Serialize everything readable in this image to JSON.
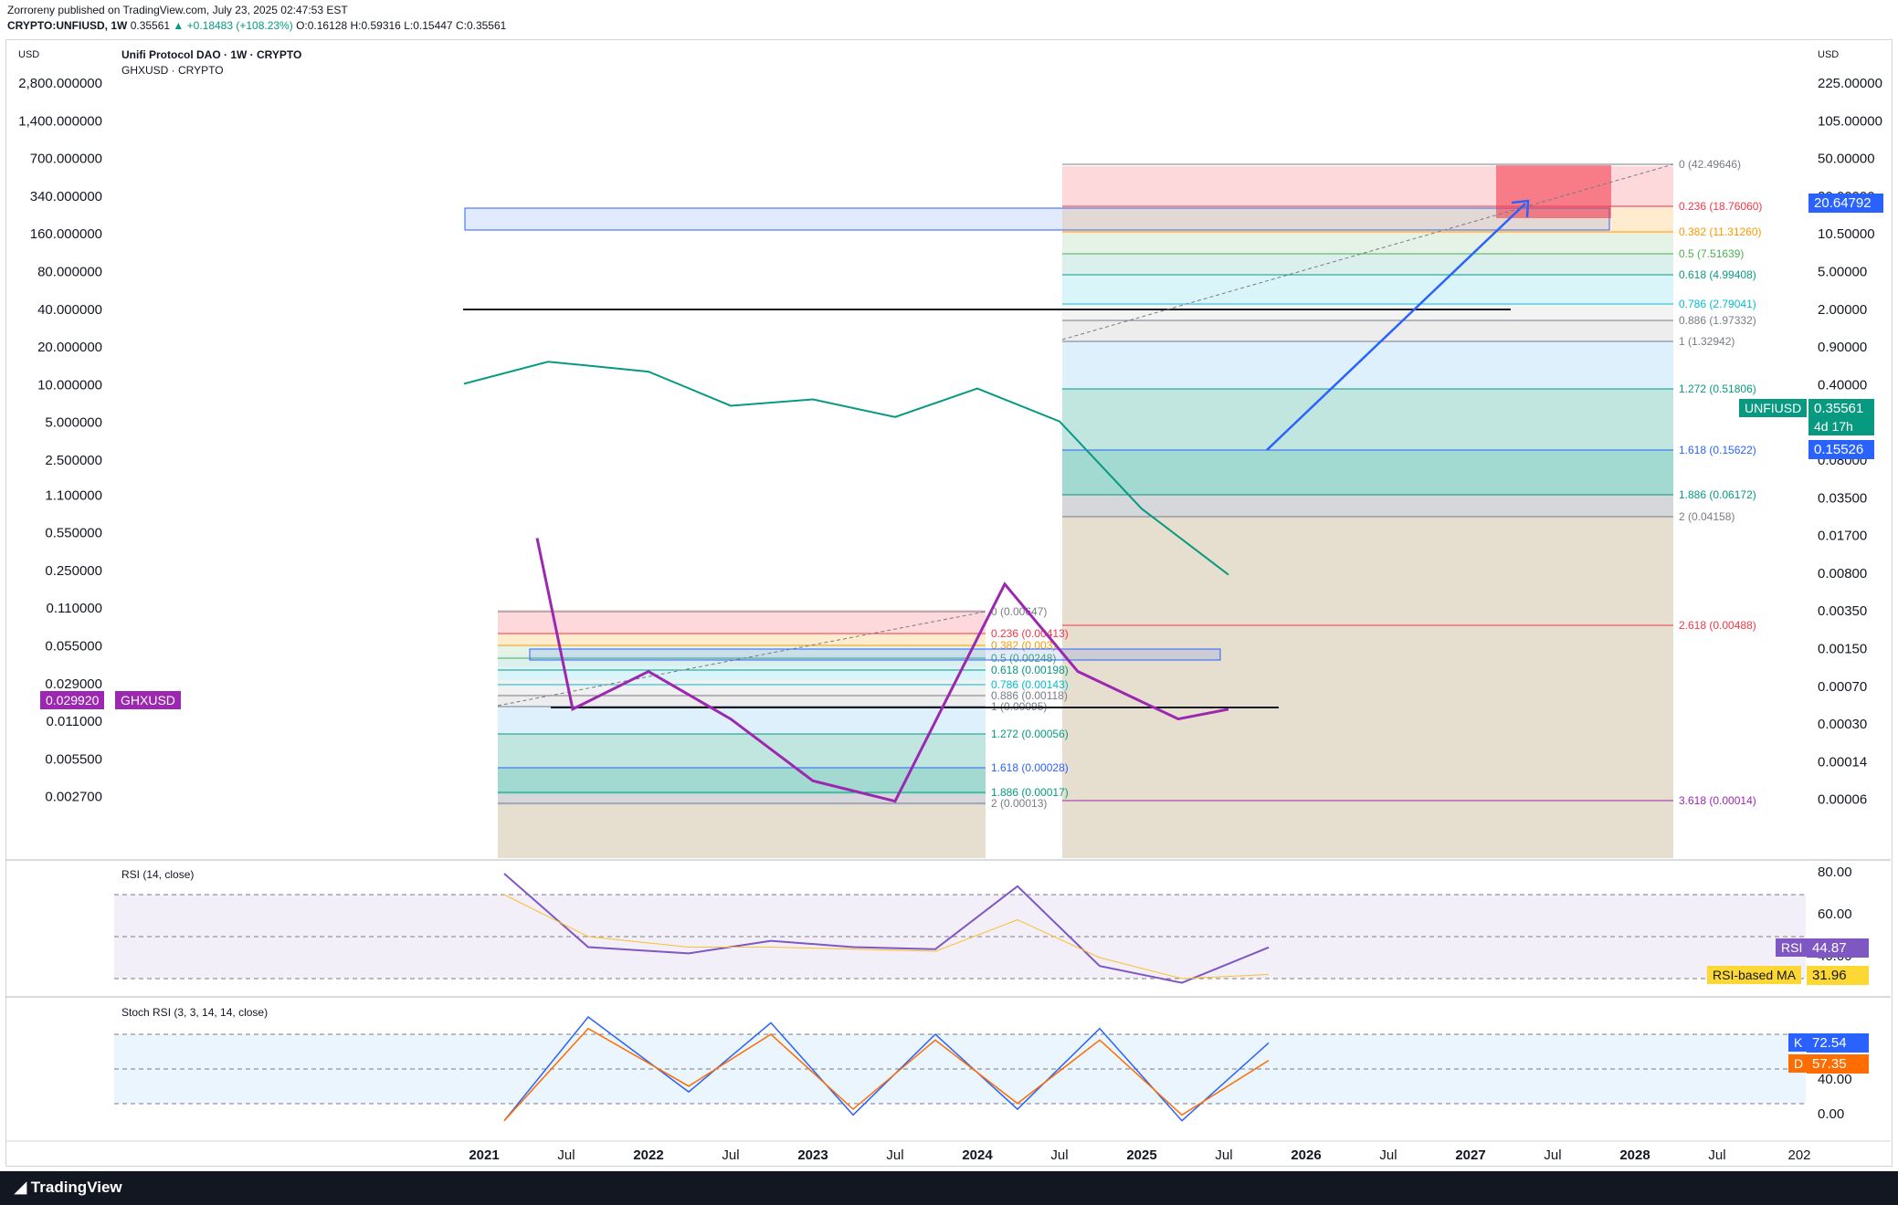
{
  "header": {
    "line1": "Zorroreny published on TradingView.com, July 23, 2025 02:47:53 EST",
    "symbol": "CRYPTO:UNFIUSD, 1W",
    "price": "0.35561",
    "change": "▲ +0.18483 (+108.23%)",
    "o": "O:0.16128",
    "h": "H:0.59316",
    "l": "L:0.15447",
    "c": "C:0.35561"
  },
  "legend": {
    "title": "Unifi Protocol DAO · 1W · CRYPTO",
    "sub": "GHXUSD · CRYPTO",
    "left_currency": "USD",
    "right_currency": "USD"
  },
  "rsi_panel": {
    "title": "RSI (14, close)",
    "rsi_label": "RSI",
    "rsi_value": "44.87",
    "ma_label": "RSI-based MA",
    "ma_value": "31.96"
  },
  "stoch_panel": {
    "title": "Stoch RSI (3, 3, 14, 14, close)",
    "k_label": "K",
    "k_value": "72.54",
    "d_label": "D",
    "d_value": "57.35"
  },
  "badges": {
    "unfi_name": "UNFIUSD",
    "unfi_price": "0.35561",
    "unfi_time": "4d 17h",
    "level_top": "20.64792",
    "level_low": "0.15526",
    "ghx_price": "0.029920",
    "ghx_name": "GHXUSD"
  },
  "footer": {
    "logo": "TradingView"
  },
  "colors": {
    "ghx": "#9c27b0",
    "up": "#089981",
    "down": "#f23645",
    "rsi": "#7e57c2",
    "blue": "#2962ff"
  },
  "chart_data": {
    "type": "line",
    "title": "Unifi Protocol DAO · 1W · CRYPTO",
    "scale": "log",
    "left_axis_ticks": [
      "2,800.000000",
      "1,400.000000",
      "700.000000",
      "340.000000",
      "160.000000",
      "80.000000",
      "40.000000",
      "20.000000",
      "10.000000",
      "5.000000",
      "2.500000",
      "1.100000",
      "0.550000",
      "0.250000",
      "0.110000",
      "0.055000",
      "0.029000",
      "0.011000",
      "0.005500",
      "0.002700"
    ],
    "right_axis_ticks": [
      "225.00000",
      "105.00000",
      "50.00000",
      "20.00000",
      "10.50000",
      "5.00000",
      "2.00000",
      "0.90000",
      "0.40000",
      "0.18000",
      "0.08000",
      "0.03500",
      "0.01700",
      "0.00800",
      "0.00350",
      "0.00150",
      "0.00070",
      "0.00030",
      "0.00014",
      "0.00006"
    ],
    "x_ticks": [
      "2021",
      "Jul",
      "2022",
      "Jul",
      "2023",
      "Jul",
      "2024",
      "Jul",
      "2025",
      "Jul",
      "2026",
      "Jul",
      "2027",
      "Jul",
      "2028",
      "Jul",
      "202"
    ],
    "fib_unfi": [
      "0 (42.49646)",
      "0.236 (18.76060)",
      "0.382 (11.31260)",
      "0.5 (7.51639)",
      "0.618 (4.99408)",
      "0.786 (2.79041)",
      "0.886 (1.97332)",
      "1 (1.32942)",
      "1.272 (0.51806)",
      "1.618 (0.15622)",
      "1.886 (0.06172)",
      "2 (0.04158)",
      "2.618 (0.00488)",
      "3.618 (0.00014)"
    ],
    "fib_ghx": [
      "0 (0.00647)",
      "0.236 (0.00413)",
      "0.382 (0.003)",
      "0.5 (0.00248)",
      "0.618 (0.00198)",
      "0.786 (0.00143)",
      "0.886 (0.00118)",
      "1 (0.00095)",
      "1.272 (0.00056)",
      "1.618 (0.00028)",
      "1.886 (0.00017)",
      "2 (0.00013)"
    ],
    "rsi_ticks": [
      "80.00",
      "60.00",
      "40.00"
    ],
    "stoch_ticks": [
      "80.00",
      "40.00",
      "0.00"
    ],
    "series": [
      {
        "name": "UNFIUSD",
        "x": [
          "2021",
          "Jul 2021",
          "2022",
          "Jul 2022",
          "2023",
          "Jul 2023",
          "2024",
          "Jul 2024",
          "2025",
          "Jul 2025"
        ],
        "values": [
          12.0,
          18.0,
          15.0,
          8.0,
          9.0,
          6.5,
          11.0,
          6.0,
          1.2,
          0.356
        ]
      },
      {
        "name": "GHXUSD",
        "x": [
          "Apr 2021",
          "Jul 2021",
          "2022",
          "Jul 2022",
          "2023",
          "Jul 2023",
          "2024",
          "Jul 2024",
          "2025",
          "Jul 2025"
        ],
        "values": [
          0.7,
          0.03,
          0.06,
          0.025,
          0.008,
          0.0055,
          0.3,
          0.06,
          0.025,
          0.0299
        ]
      },
      {
        "name": "RSI",
        "x": [
          "2021",
          "Jul 2021",
          "2022",
          "Jul 2022",
          "2023",
          "Jul 2023",
          "2024",
          "Jul 2024",
          "2025",
          "Jul 2025"
        ],
        "values": [
          80,
          45,
          42,
          48,
          45,
          44,
          74,
          36,
          28,
          44.87
        ]
      },
      {
        "name": "RSI-based MA",
        "values": [
          70,
          50,
          45,
          45,
          44,
          43,
          58,
          40,
          30,
          31.96
        ]
      },
      {
        "name": "K",
        "values": [
          5,
          95,
          30,
          90,
          10,
          80,
          15,
          85,
          5,
          72.54
        ]
      },
      {
        "name": "D",
        "values": [
          5,
          85,
          35,
          80,
          15,
          75,
          20,
          75,
          10,
          57.35
        ]
      }
    ]
  }
}
